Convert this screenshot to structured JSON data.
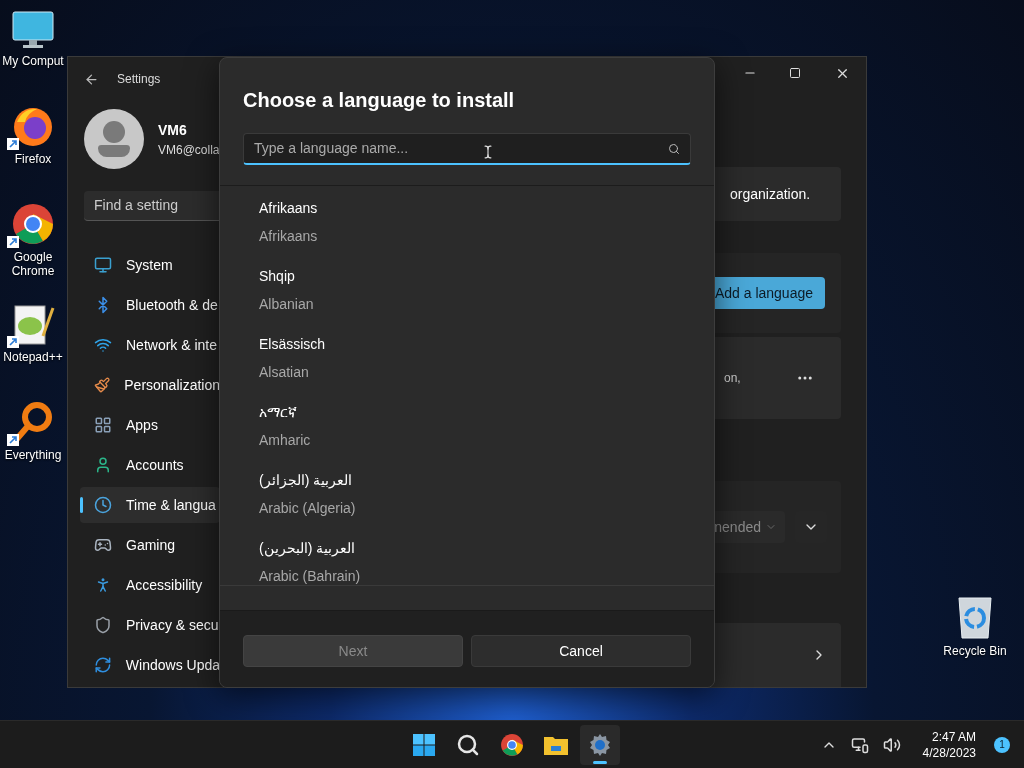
{
  "desktop_icons": [
    {
      "kind": "computer",
      "label": "My Comput"
    },
    {
      "kind": "firefox",
      "label": "Firefox"
    },
    {
      "kind": "chrome",
      "label": "Google Chrome"
    },
    {
      "kind": "notepad",
      "label": "Notepad++"
    },
    {
      "kind": "everything",
      "label": "Everything"
    },
    {
      "kind": "recycle",
      "label": "Recycle Bin"
    }
  ],
  "settings": {
    "title": "Settings",
    "user": {
      "name": "VM6",
      "email": "VM6@colla"
    },
    "search": {
      "placeholder": "Find a setting"
    },
    "nav": [
      {
        "kind": "system",
        "label": "System",
        "selected": false
      },
      {
        "kind": "bluetooth",
        "label": "Bluetooth & de",
        "selected": false
      },
      {
        "kind": "network",
        "label": "Network & inte",
        "selected": false
      },
      {
        "kind": "brush",
        "label": "Personalization",
        "selected": false
      },
      {
        "kind": "apps",
        "label": "Apps",
        "selected": false
      },
      {
        "kind": "accounts",
        "label": "Accounts",
        "selected": false
      },
      {
        "kind": "time",
        "label": "Time & langua",
        "selected": true
      },
      {
        "kind": "gaming",
        "label": "Gaming",
        "selected": false
      },
      {
        "kind": "accessibility",
        "label": "Accessibility",
        "selected": false
      },
      {
        "kind": "privacy",
        "label": "Privacy & secu",
        "selected": false
      },
      {
        "kind": "update",
        "label": "Windows Upda",
        "selected": false
      }
    ],
    "content": {
      "notice": "organization.",
      "add_button": "Add a language",
      "language_card_text": "on,",
      "dropdown_value": "nended"
    }
  },
  "dialog": {
    "title": "Choose a language to install",
    "search": {
      "placeholder": "Type a language name..."
    },
    "languages": [
      {
        "native": "Afrikaans",
        "english": "Afrikaans"
      },
      {
        "native": "Shqip",
        "english": "Albanian"
      },
      {
        "native": "Elsässisch",
        "english": "Alsatian"
      },
      {
        "native": "አማርኛ",
        "english": "Amharic"
      },
      {
        "native": "العربية (الجزائر)",
        "english": "Arabic (Algeria)"
      },
      {
        "native": "العربية (البحرين)",
        "english": "Arabic (Bahrain)"
      }
    ],
    "buttons": [
      {
        "label": "Next",
        "disabled": true
      },
      {
        "label": "Cancel",
        "disabled": false
      }
    ]
  },
  "taskbar": {
    "apps": [
      {
        "kind": "start",
        "selected": false
      },
      {
        "kind": "search",
        "selected": false
      },
      {
        "kind": "chrome",
        "selected": false
      },
      {
        "kind": "explorer",
        "selected": false
      },
      {
        "kind": "settings",
        "selected": true
      }
    ],
    "time": "2:47 AM",
    "date": "4/28/2023",
    "notifications": "1"
  }
}
